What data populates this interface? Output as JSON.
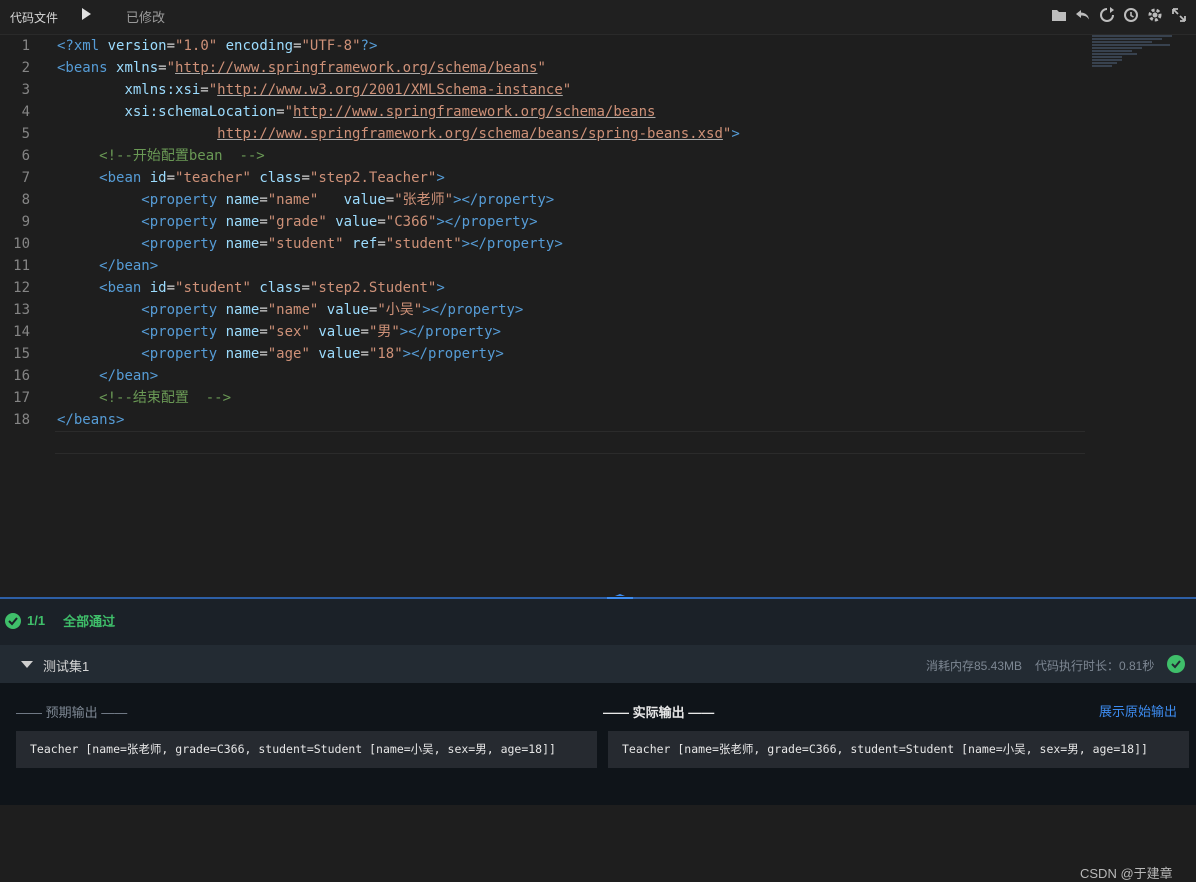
{
  "toolbar": {
    "tab_label": "代码文件",
    "status": "已修改",
    "icons": [
      "folder-icon",
      "undo-icon",
      "refresh-icon",
      "history-icon",
      "gear-icon",
      "fullscreen-icon"
    ]
  },
  "editor": {
    "line_numbers": [
      "1",
      "2",
      "3",
      "4",
      "5",
      "6",
      "7",
      "8",
      "9",
      "10",
      "11",
      "12",
      "13",
      "14",
      "15",
      "16",
      "17",
      "18"
    ],
    "lines": [
      [
        {
          "t": "<?xml ",
          "c": "tag"
        },
        {
          "t": "version",
          "c": "attr"
        },
        {
          "t": "=",
          "c": ""
        },
        {
          "t": "\"1.0\"",
          "c": "str"
        },
        {
          "t": " ",
          "c": ""
        },
        {
          "t": "encoding",
          "c": "attr"
        },
        {
          "t": "=",
          "c": ""
        },
        {
          "t": "\"UTF-8\"",
          "c": "str"
        },
        {
          "t": "?>",
          "c": "tag"
        }
      ],
      [
        {
          "t": "<beans ",
          "c": "tag"
        },
        {
          "t": "xmlns",
          "c": "attr"
        },
        {
          "t": "=",
          "c": ""
        },
        {
          "t": "\"",
          "c": "str"
        },
        {
          "t": "http://www.springframework.org/schema/beans",
          "c": "str url"
        },
        {
          "t": "\"",
          "c": "str"
        }
      ],
      [
        {
          "t": "        ",
          "c": ""
        },
        {
          "t": "xmlns:xsi",
          "c": "attr"
        },
        {
          "t": "=",
          "c": ""
        },
        {
          "t": "\"",
          "c": "str"
        },
        {
          "t": "http://www.w3.org/2001/XMLSchema-instance",
          "c": "str url"
        },
        {
          "t": "\"",
          "c": "str"
        }
      ],
      [
        {
          "t": "        ",
          "c": ""
        },
        {
          "t": "xsi:schemaLocation",
          "c": "attr"
        },
        {
          "t": "=",
          "c": ""
        },
        {
          "t": "\"",
          "c": "str"
        },
        {
          "t": "http://www.springframework.org/schema/beans",
          "c": "str url"
        }
      ],
      [
        {
          "t": "                   ",
          "c": ""
        },
        {
          "t": "http://www.springframework.org/schema/beans/spring-beans.xsd",
          "c": "str url"
        },
        {
          "t": "\"",
          "c": "str"
        },
        {
          "t": ">",
          "c": "tag"
        }
      ],
      [
        {
          "t": "     ",
          "c": ""
        },
        {
          "t": "<!--开始配置bean  -->",
          "c": "cmt"
        }
      ],
      [
        {
          "t": "     ",
          "c": ""
        },
        {
          "t": "<bean ",
          "c": "tag"
        },
        {
          "t": "id",
          "c": "attr"
        },
        {
          "t": "=",
          "c": ""
        },
        {
          "t": "\"teacher\"",
          "c": "str"
        },
        {
          "t": " ",
          "c": ""
        },
        {
          "t": "class",
          "c": "attr"
        },
        {
          "t": "=",
          "c": ""
        },
        {
          "t": "\"step2.Teacher\"",
          "c": "str"
        },
        {
          "t": ">",
          "c": "tag"
        }
      ],
      [
        {
          "t": "          ",
          "c": ""
        },
        {
          "t": "<property ",
          "c": "tag"
        },
        {
          "t": "name",
          "c": "attr"
        },
        {
          "t": "=",
          "c": ""
        },
        {
          "t": "\"name\"",
          "c": "str"
        },
        {
          "t": "   ",
          "c": ""
        },
        {
          "t": "value",
          "c": "attr"
        },
        {
          "t": "=",
          "c": ""
        },
        {
          "t": "\"张老师\"",
          "c": "str"
        },
        {
          "t": "></property>",
          "c": "tag"
        }
      ],
      [
        {
          "t": "          ",
          "c": ""
        },
        {
          "t": "<property ",
          "c": "tag"
        },
        {
          "t": "name",
          "c": "attr"
        },
        {
          "t": "=",
          "c": ""
        },
        {
          "t": "\"grade\"",
          "c": "str"
        },
        {
          "t": " ",
          "c": ""
        },
        {
          "t": "value",
          "c": "attr"
        },
        {
          "t": "=",
          "c": ""
        },
        {
          "t": "\"C366\"",
          "c": "str"
        },
        {
          "t": "></property>",
          "c": "tag"
        }
      ],
      [
        {
          "t": "          ",
          "c": ""
        },
        {
          "t": "<property ",
          "c": "tag"
        },
        {
          "t": "name",
          "c": "attr"
        },
        {
          "t": "=",
          "c": ""
        },
        {
          "t": "\"student\"",
          "c": "str"
        },
        {
          "t": " ",
          "c": ""
        },
        {
          "t": "ref",
          "c": "attr"
        },
        {
          "t": "=",
          "c": ""
        },
        {
          "t": "\"student\"",
          "c": "str"
        },
        {
          "t": "></property>",
          "c": "tag"
        }
      ],
      [
        {
          "t": "     ",
          "c": ""
        },
        {
          "t": "</bean>",
          "c": "tag"
        }
      ],
      [
        {
          "t": "     ",
          "c": ""
        },
        {
          "t": "<bean ",
          "c": "tag"
        },
        {
          "t": "id",
          "c": "attr"
        },
        {
          "t": "=",
          "c": ""
        },
        {
          "t": "\"student\"",
          "c": "str"
        },
        {
          "t": " ",
          "c": ""
        },
        {
          "t": "class",
          "c": "attr"
        },
        {
          "t": "=",
          "c": ""
        },
        {
          "t": "\"step2.Student\"",
          "c": "str"
        },
        {
          "t": ">",
          "c": "tag"
        }
      ],
      [
        {
          "t": "          ",
          "c": ""
        },
        {
          "t": "<property ",
          "c": "tag"
        },
        {
          "t": "name",
          "c": "attr"
        },
        {
          "t": "=",
          "c": ""
        },
        {
          "t": "\"name\"",
          "c": "str"
        },
        {
          "t": " ",
          "c": ""
        },
        {
          "t": "value",
          "c": "attr"
        },
        {
          "t": "=",
          "c": ""
        },
        {
          "t": "\"小吴\"",
          "c": "str"
        },
        {
          "t": "></property>",
          "c": "tag"
        }
      ],
      [
        {
          "t": "          ",
          "c": ""
        },
        {
          "t": "<property ",
          "c": "tag"
        },
        {
          "t": "name",
          "c": "attr"
        },
        {
          "t": "=",
          "c": ""
        },
        {
          "t": "\"sex\"",
          "c": "str"
        },
        {
          "t": " ",
          "c": ""
        },
        {
          "t": "value",
          "c": "attr"
        },
        {
          "t": "=",
          "c": ""
        },
        {
          "t": "\"男\"",
          "c": "str"
        },
        {
          "t": "></property>",
          "c": "tag"
        }
      ],
      [
        {
          "t": "          ",
          "c": ""
        },
        {
          "t": "<property ",
          "c": "tag"
        },
        {
          "t": "name",
          "c": "attr"
        },
        {
          "t": "=",
          "c": ""
        },
        {
          "t": "\"age\"",
          "c": "str"
        },
        {
          "t": " ",
          "c": ""
        },
        {
          "t": "value",
          "c": "attr"
        },
        {
          "t": "=",
          "c": ""
        },
        {
          "t": "\"18\"",
          "c": "str"
        },
        {
          "t": "></property>",
          "c": "tag"
        }
      ],
      [
        {
          "t": "     ",
          "c": ""
        },
        {
          "t": "</bean>",
          "c": "tag"
        }
      ],
      [
        {
          "t": "     ",
          "c": ""
        },
        {
          "t": "<!--结束配置  -->",
          "c": "cmt"
        }
      ],
      [
        {
          "t": "</beans>",
          "c": "tag"
        }
      ]
    ]
  },
  "results": {
    "count": "1/1",
    "status": "全部通过",
    "set_title": "测试集1",
    "memory": "消耗内存85.43MB",
    "duration": "代码执行时长：0.81秒",
    "expected_label": "—— 预期输出 ——",
    "actual_label": "—— 实际输出 ——",
    "raw_link": "展示原始输出",
    "expected_output": "Teacher [name=张老师, grade=C366, student=Student [name=小吴, sex=男, age=18]]",
    "actual_output": "Teacher [name=张老师, grade=C366, student=Student [name=小吴, sex=男, age=18]]"
  },
  "watermark": "CSDN @于建章",
  "colors": {
    "accent": "#3d8cf0",
    "success": "#3fbf6a",
    "divider": "#2d5fa6"
  }
}
